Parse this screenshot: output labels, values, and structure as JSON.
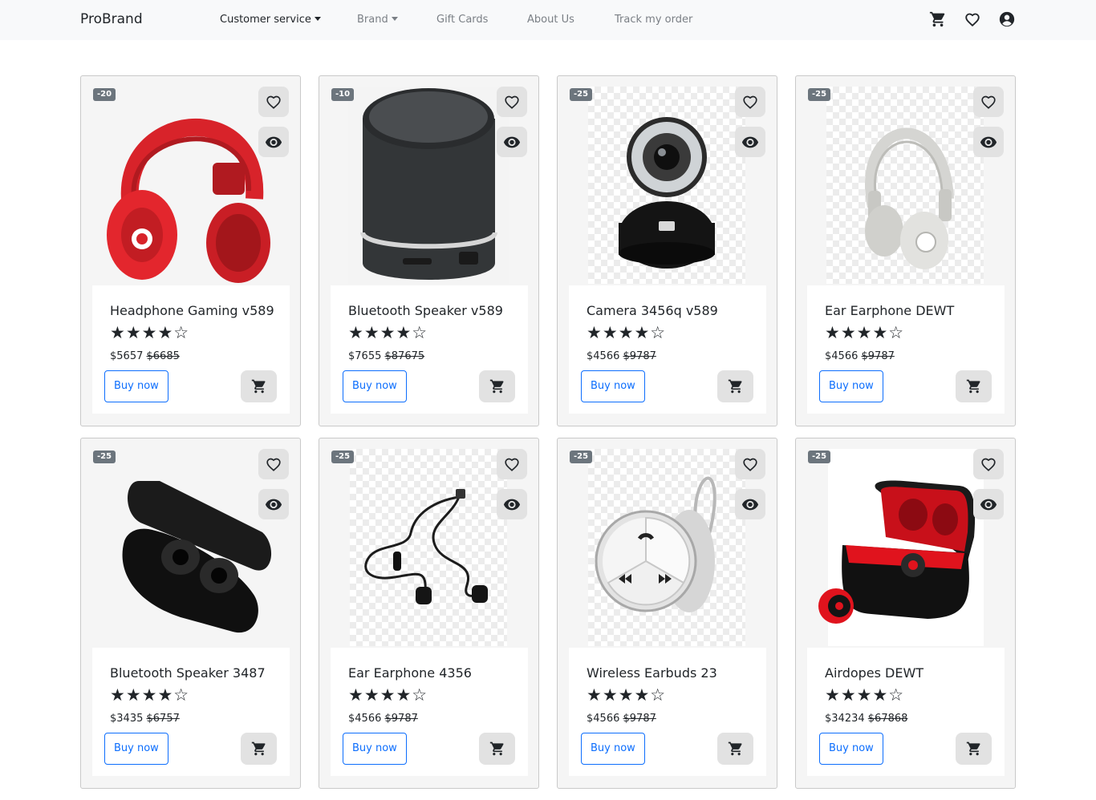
{
  "nav": {
    "brand": "ProBrand",
    "items": [
      {
        "label": "Customer service",
        "dropdown": true
      },
      {
        "label": "Brand",
        "dropdown": true
      },
      {
        "label": "Gift Cards",
        "dropdown": false
      },
      {
        "label": "About Us",
        "dropdown": false
      },
      {
        "label": "Track my order",
        "dropdown": false
      }
    ],
    "icons": [
      "cart-icon",
      "heart-icon",
      "user-icon"
    ]
  },
  "products": [
    {
      "discount": "-20",
      "name": "Headphone Gaming v589",
      "stars": "★★★★☆",
      "price": "$5657",
      "old_price": "$6685",
      "buy_label": "Buy now",
      "image": "red-headphones"
    },
    {
      "discount": "-10",
      "name": "Bluetooth Speaker v589",
      "stars": "★★★★☆",
      "price": "$7655",
      "old_price": "$87675",
      "buy_label": "Buy now",
      "image": "black-speaker"
    },
    {
      "discount": "-25",
      "name": "Camera 3456q v589",
      "stars": "★★★★☆",
      "price": "$4566",
      "old_price": "$9787",
      "buy_label": "Buy now",
      "image": "webcam"
    },
    {
      "discount": "-25",
      "name": "Ear Earphone DEWT",
      "stars": "★★★★☆",
      "price": "$4566",
      "old_price": "$9787",
      "buy_label": "Buy now",
      "image": "white-headphones"
    },
    {
      "discount": "-25",
      "name": "Bluetooth Speaker 3487",
      "stars": "★★★★☆",
      "price": "$3435",
      "old_price": "$6757",
      "buy_label": "Buy now",
      "image": "black-earbuds-case"
    },
    {
      "discount": "-25",
      "name": "Ear Earphone 4356",
      "stars": "★★★★☆",
      "price": "$4566",
      "old_price": "$9787",
      "buy_label": "Buy now",
      "image": "wired-earphones"
    },
    {
      "discount": "-25",
      "name": "Wireless Earbuds 23",
      "stars": "★★★★☆",
      "price": "$4566",
      "old_price": "$9787",
      "buy_label": "Buy now",
      "image": "bluetooth-headset"
    },
    {
      "discount": "-25",
      "name": "Airdopes DEWT",
      "stars": "★★★★☆",
      "price": "$34234",
      "old_price": "$67868",
      "buy_label": "Buy now",
      "image": "red-earbuds-case"
    }
  ],
  "colors": {
    "navbar_bg": "#f8f9fa",
    "card_bg": "#f5f5f5",
    "badge_bg": "#6c757d",
    "button_primary": "#0d6efd",
    "icon_button_bg": "#e2e2e2"
  }
}
